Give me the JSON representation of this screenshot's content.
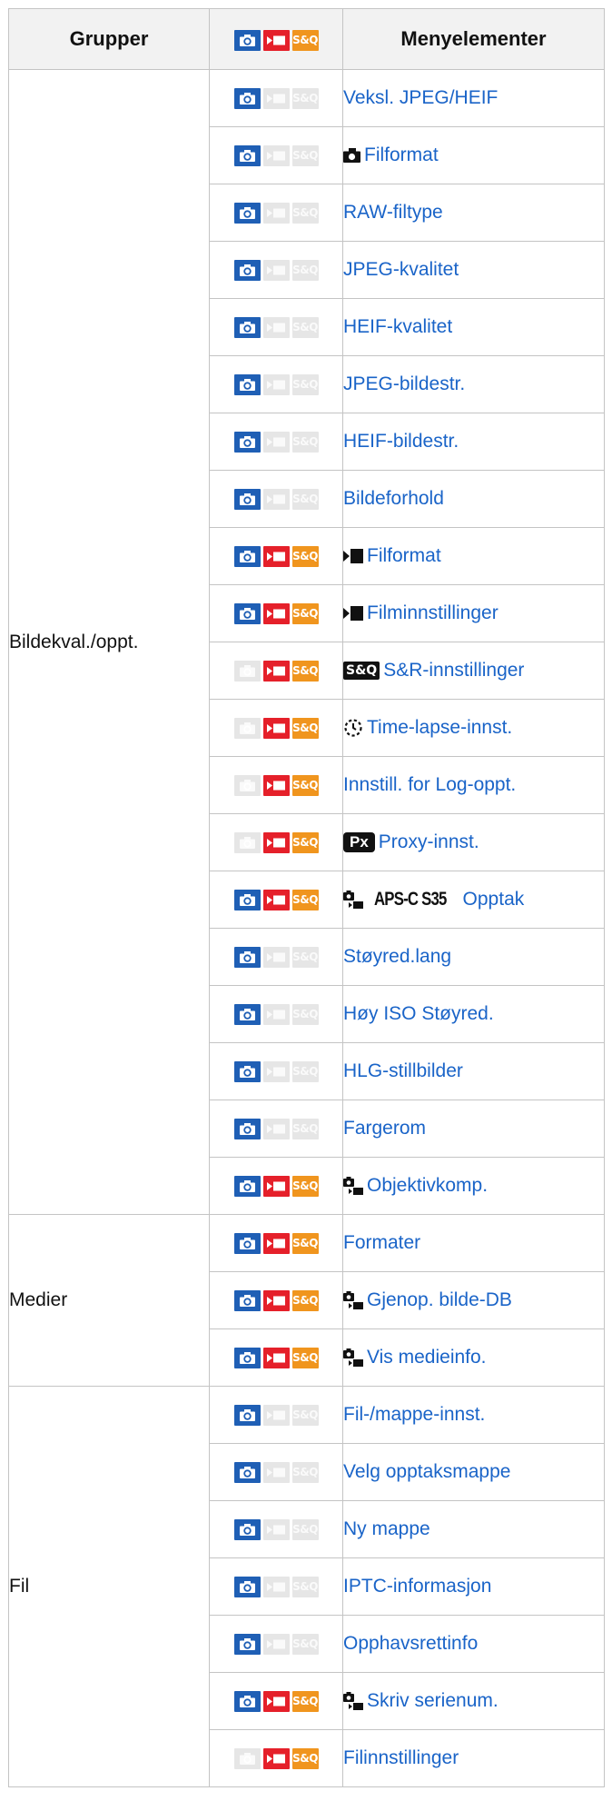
{
  "header": {
    "groups": "Grupper",
    "menu_items": "Menyelementer",
    "mode_icons": [
      "photo-mode-icon",
      "movie-mode-icon",
      "sq-mode-icon"
    ],
    "sq_label": "S&Q"
  },
  "icon_labels": {
    "sq": "S&Q"
  },
  "colors": {
    "photo": "#1f5fb5",
    "movie": "#e5202a",
    "sq": "#f0951e",
    "inactive": "#e6e6e6",
    "link": "#1a64c8"
  },
  "groups": [
    {
      "name": "Bildekval./oppt.",
      "rows": [
        {
          "label": "Veksl. JPEG/HEIF",
          "modes": [
            true,
            false,
            false
          ],
          "prefix": ""
        },
        {
          "label": "Filformat",
          "modes": [
            true,
            false,
            false
          ],
          "prefix": "camera-icon"
        },
        {
          "label": "RAW-filtype",
          "modes": [
            true,
            false,
            false
          ],
          "prefix": ""
        },
        {
          "label": "JPEG-kvalitet",
          "modes": [
            true,
            false,
            false
          ],
          "prefix": ""
        },
        {
          "label": "HEIF-kvalitet",
          "modes": [
            true,
            false,
            false
          ],
          "prefix": ""
        },
        {
          "label": "JPEG-bildestr.",
          "modes": [
            true,
            false,
            false
          ],
          "prefix": ""
        },
        {
          "label": "HEIF-bildestr.",
          "modes": [
            true,
            false,
            false
          ],
          "prefix": ""
        },
        {
          "label": "Bildeforhold",
          "modes": [
            true,
            false,
            false
          ],
          "prefix": ""
        },
        {
          "label": "Filformat",
          "modes": [
            true,
            true,
            true
          ],
          "prefix": "movie-icon"
        },
        {
          "label": "Filminnstillinger",
          "modes": [
            true,
            true,
            true
          ],
          "prefix": "movie-icon"
        },
        {
          "label": "S&R-innstillinger",
          "modes": [
            false,
            true,
            true
          ],
          "prefix": "sq-badge",
          "prefix_text": "S&Q"
        },
        {
          "label": "Time-lapse-innst.",
          "modes": [
            false,
            true,
            true
          ],
          "prefix": "timelapse-icon"
        },
        {
          "label": "Innstill. for Log-oppt.",
          "modes": [
            false,
            true,
            true
          ],
          "prefix": ""
        },
        {
          "label": "Proxy-innst.",
          "modes": [
            false,
            true,
            true
          ],
          "prefix": "px-badge",
          "prefix_text": "Px"
        },
        {
          "label": "Opptak",
          "modes": [
            true,
            true,
            true
          ],
          "prefix": "photo-movie-aps",
          "prefix_text": "APS-C S35"
        },
        {
          "label": "Støyred.lang",
          "modes": [
            true,
            false,
            false
          ],
          "prefix": ""
        },
        {
          "label": "Høy ISO Støyred.",
          "modes": [
            true,
            false,
            false
          ],
          "prefix": ""
        },
        {
          "label": "HLG-stillbilder",
          "modes": [
            true,
            false,
            false
          ],
          "prefix": ""
        },
        {
          "label": "Fargerom",
          "modes": [
            true,
            false,
            false
          ],
          "prefix": ""
        },
        {
          "label": "Objektivkomp.",
          "modes": [
            true,
            true,
            true
          ],
          "prefix": "photo-movie-icon"
        }
      ]
    },
    {
      "name": "Medier",
      "rows": [
        {
          "label": "Formater",
          "modes": [
            true,
            true,
            true
          ],
          "prefix": ""
        },
        {
          "label": "Gjenop. bilde-DB",
          "modes": [
            true,
            true,
            true
          ],
          "prefix": "photo-movie-icon"
        },
        {
          "label": "Vis medieinfo.",
          "modes": [
            true,
            true,
            true
          ],
          "prefix": "photo-movie-icon"
        }
      ]
    },
    {
      "name": "Fil",
      "rows": [
        {
          "label": "Fil-/mappe-innst.",
          "modes": [
            true,
            false,
            false
          ],
          "prefix": ""
        },
        {
          "label": "Velg opptaksmappe",
          "modes": [
            true,
            false,
            false
          ],
          "prefix": ""
        },
        {
          "label": "Ny mappe",
          "modes": [
            true,
            false,
            false
          ],
          "prefix": ""
        },
        {
          "label": "IPTC-informasjon",
          "modes": [
            true,
            false,
            false
          ],
          "prefix": ""
        },
        {
          "label": "Opphavsrettinfo",
          "modes": [
            true,
            false,
            false
          ],
          "prefix": ""
        },
        {
          "label": "Skriv serienum.",
          "modes": [
            true,
            true,
            true
          ],
          "prefix": "photo-movie-icon"
        },
        {
          "label": "Filinnstillinger",
          "modes": [
            false,
            true,
            true
          ],
          "prefix": ""
        }
      ]
    }
  ]
}
